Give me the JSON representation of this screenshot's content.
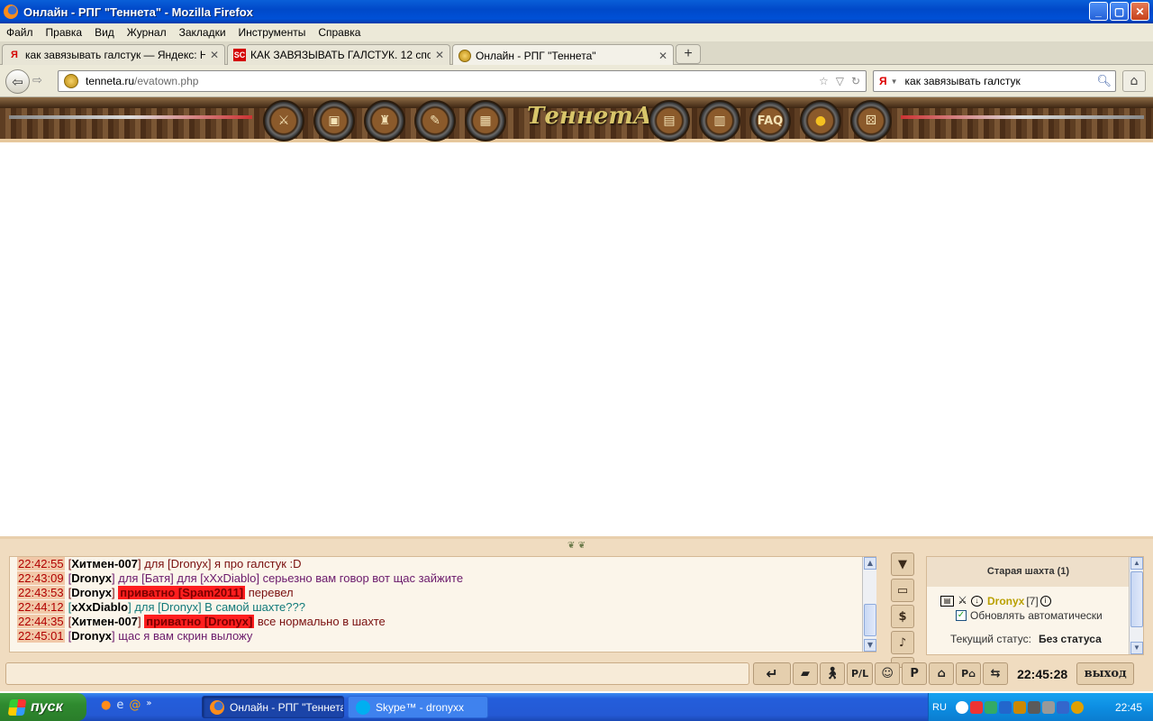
{
  "window": {
    "title": "Онлайн - РПГ \"Теннета\" - Mozilla Firefox",
    "buttons": {
      "minimize": "_",
      "maximize": "▢",
      "close": "✕"
    }
  },
  "menu": [
    "Файл",
    "Правка",
    "Вид",
    "Журнал",
    "Закладки",
    "Инструменты",
    "Справка"
  ],
  "tabs": [
    {
      "label": "как завязывать галстук — Яндекс: На...",
      "favicon": "Я",
      "favicon_color": "#d40000"
    },
    {
      "label": "КАК ЗАВЯЗЫВАТЬ ГАЛСТУК. 12 способ...",
      "favicon": "SC",
      "favicon_color": "#d40000"
    },
    {
      "label": "Онлайн - РПГ \"Теннета\"",
      "favicon": "coin-icon",
      "favicon_color": "#c59a1a"
    }
  ],
  "newtab_label": "+",
  "nav": {
    "url_domain": "tenneta.ru",
    "url_path": "/evatown.php",
    "search_engine": "Я",
    "search_value": "как завязывать галстук"
  },
  "game": {
    "logo": "ТеннетА",
    "nav_icons": [
      "swords-icon",
      "chest-icon",
      "shop-icon",
      "scroll-icon",
      "map-icon",
      "book-icon",
      "quest-scroll-icon",
      "faq-icon",
      "coins-icon",
      "dice-icon"
    ],
    "faq_label": "FAQ"
  },
  "chat": {
    "messages": [
      {
        "time": "22:42:55",
        "name": "Хитмен-007",
        "rest": "для [Dronyx] я про галстук :D",
        "style": "maroon"
      },
      {
        "time": "22:43:09",
        "name": "Dronyx",
        "rest": "для [Батя] для [xXxDiablo] серьезно вам говор вот щас зайжите",
        "style": "purple"
      },
      {
        "time": "22:43:53",
        "name": "Dronyx",
        "private": "приватно [Spam2011]",
        "rest": "перевел",
        "style": "maroon"
      },
      {
        "time": "22:44:12",
        "name": "xXxDiablo",
        "rest": "для [Dronyx] В самой шахте???",
        "style": "teal"
      },
      {
        "time": "22:44:35",
        "name": "Хитмен-007",
        "private": "приватно [Dronyx]",
        "rest": "все нормально в шахте",
        "style": "maroon"
      },
      {
        "time": "22:45:01",
        "name": "Dronyx",
        "rest": "щас я вам скрин выложу",
        "style": "purple"
      }
    ],
    "side_tools": [
      "filter-icon",
      "monitor-icon",
      "$",
      "♪",
      "person-icon"
    ],
    "input_value": ""
  },
  "location": {
    "title": "Старая шахта (1)",
    "player_name": "Dronyx",
    "player_level": "[7]",
    "auto_update_label": "Обновлять автоматически",
    "auto_update_checked": true,
    "status_label": "Текущий статус:",
    "status_value": "Без статуса"
  },
  "commands": {
    "enter": "↵",
    "buttons": [
      "eraser-icon",
      "walk-icon",
      "P/L",
      "smile-icon",
      "P",
      "home-icon",
      "P-home",
      "swap-icon"
    ],
    "clock": "22:45:28",
    "exit": "выход"
  },
  "taskbar": {
    "start": "пуск",
    "items": [
      {
        "label": "Онлайн - РПГ \"Теннета...",
        "active": true
      },
      {
        "label": "Skype™ - dronyxx",
        "active": false
      }
    ],
    "lang": "RU",
    "clock": "22:45"
  }
}
